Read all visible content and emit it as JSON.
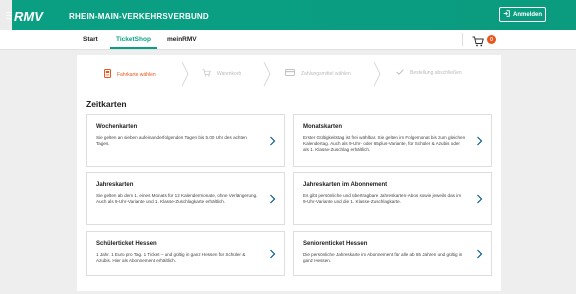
{
  "header": {
    "logo_text": "RMV",
    "brand": "RHEIN-MAIN-VERKEHRSVERBUND",
    "login_label": "Anmelden"
  },
  "nav": {
    "items": [
      {
        "label": "Start"
      },
      {
        "label": "TicketShop"
      },
      {
        "label": "meinRMV"
      }
    ],
    "active": "TicketShop",
    "cart_count": "0"
  },
  "steps": [
    {
      "label": "Fahrkarte wählen",
      "icon": "ticket-machine-icon",
      "active": true
    },
    {
      "label": "Warenkorb",
      "icon": "cart-icon",
      "active": false
    },
    {
      "label": "Zahlungsmittel wählen",
      "icon": "credit-card-icon",
      "active": false
    },
    {
      "label": "Bestellung abschließen",
      "icon": "checkmark-icon",
      "active": false
    }
  ],
  "section_title": "Zeitkarten",
  "cards": [
    {
      "title": "Wochenkarten",
      "desc": "Sie gelten an sieben aufeinanderfolgenden Tagen bis 5.00 Uhr des achten Tages."
    },
    {
      "title": "Monatskarten",
      "desc": "Erster Gültigkeitstag ist frei wählbar. Sie gelten im Folgemonat bis zum gleichen Kalendertag. Auch als 9-Uhr- oder 65plus-Variante, für Schüler & Azubis oder als 1. Klasse-Zuschlag erhältlich."
    },
    {
      "title": "Jahreskarten",
      "desc": "Sie gelten ab dem 1. eines Monats für 12 Kalendermonate, ohne Verlängerung. Auch als 9-Uhr-Variante und 1. Klasse-Zuschlagkarte erhältlich."
    },
    {
      "title": "Jahreskarten im Abonnement",
      "desc": "Es gibt persönliche und übertragbare Jahreskarten-Abos sowie jeweils das im 9-Uhr-Variante und die 1. Klasse-Zuschlagkarte."
    },
    {
      "title": "Schülerticket Hessen",
      "desc": "1 Jahr. 1 Euro pro Tag. 1 Ticket – und gültig in ganz Hessen für Schüler & Azubis. Hier als Abonnement erhältlich."
    },
    {
      "title": "Seniorenticket Hessen",
      "desc": "Die persönliche Jahreskarte im Abonnement für alle ab 65 Jahren und gültig in ganz Hessen."
    }
  ],
  "colors": {
    "brand_green": "#0a9f83",
    "accent_orange": "#e8571c"
  }
}
